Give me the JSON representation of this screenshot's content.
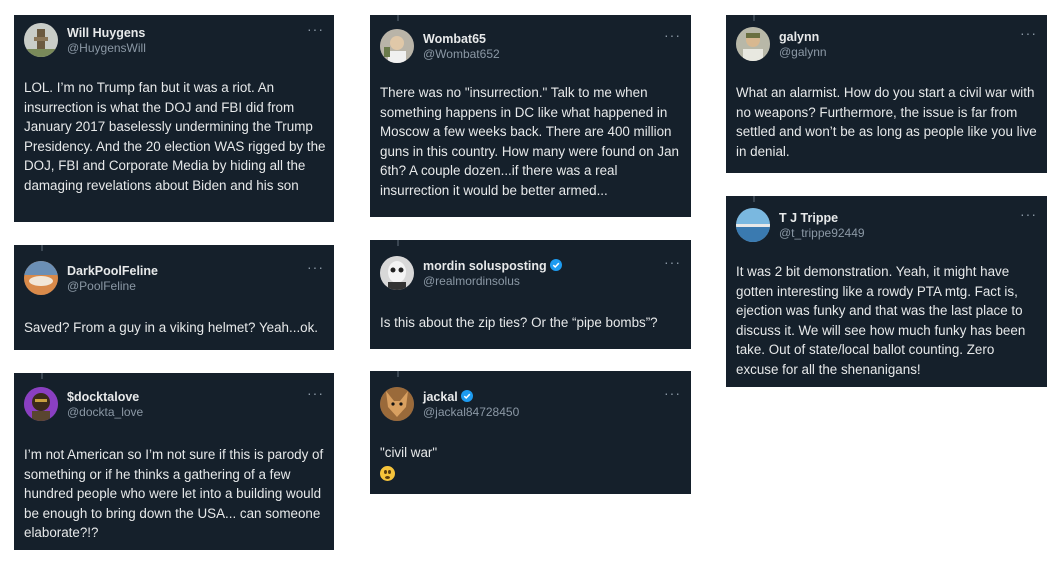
{
  "tweets": [
    {
      "name": "Will Huygens",
      "handle": "@HuygensWill",
      "text": "LOL.  I’m no Trump fan but it was a riot.  An insurrection is what the DOJ and FBI did from January 2017 baselessly undermining the Trump Presidency.  And the 20 election WAS rigged by the DOJ, FBI and Corporate Media by hiding all the damaging revelations about Biden and his son"
    },
    {
      "name": "DarkPoolFeline",
      "handle": "@PoolFeline",
      "text": "Saved? From a guy in a viking helmet? Yeah...ok."
    },
    {
      "name": "$docktalove",
      "handle": "@dockta_love",
      "text": "I’m not American so I’m not sure if this is parody of something or if he thinks a gathering of a few hundred people who were let into a building would be enough to bring down the USA... can someone elaborate?!?"
    },
    {
      "name": "Wombat65",
      "handle": "@Wombat652",
      "text": "There was no \"insurrection.\"  Talk to me when something happens in DC like what happened in Moscow a few weeks back.  There are 400 million guns in this country.  How many were found on Jan 6th? A couple dozen...if there was a real insurrection it would be better armed..."
    },
    {
      "name": "mordin solusposting",
      "handle": "@realmordinsolus",
      "text": "Is this about the zip ties? Or the “pipe bombs”?"
    },
    {
      "name": "jackal",
      "handle": "@jackal84728450",
      "text": "\"civil war\""
    },
    {
      "name": "galynn",
      "handle": "@galynn",
      "text": "What an alarmist. How do you start a civil war with no weapons?  Furthermore, the issue is far from settled and won’t be as long as people like you live in denial."
    },
    {
      "name": "T J Trippe",
      "handle": "@t_trippe92449",
      "text": "It was 2 bit demonstration. Yeah, it might have gotten interesting like a rowdy PTA mtg.  Fact is, ejection was funky and that was the last place to discuss it.  We will see how much funky has been take. Out of state/local ballot counting. Zero excuse for all the shenanigans!"
    }
  ],
  "more_label": "···",
  "colors": {
    "card": "#15202b",
    "text": "#e7e9ea",
    "muted": "#8b98a5",
    "verified": "#1d9bf0"
  }
}
